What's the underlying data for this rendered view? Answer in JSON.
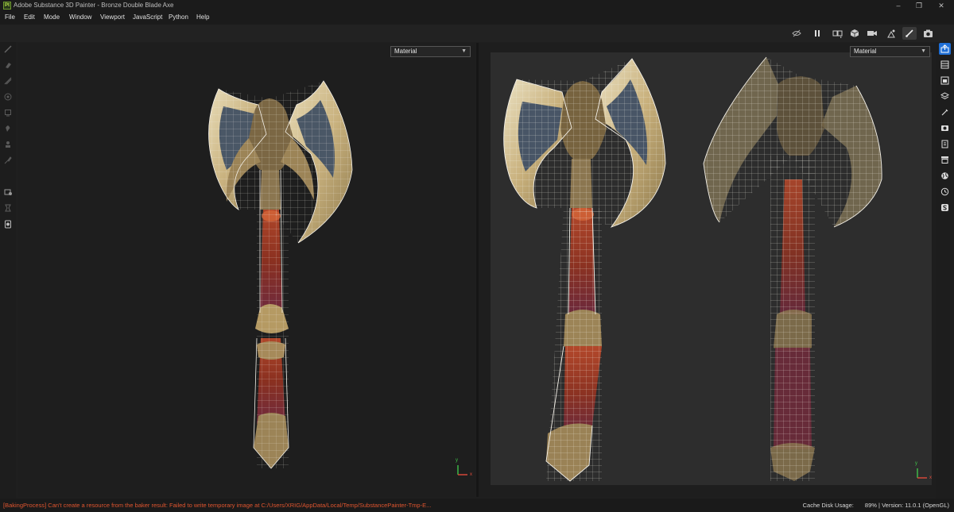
{
  "window": {
    "title": "Adobe Substance 3D Painter - Bronze Double Blade Axe",
    "app_icon": "Pt",
    "controls": [
      "minimize-icon",
      "maximize-icon",
      "close-icon"
    ]
  },
  "menu": [
    "File",
    "Edit",
    "Mode",
    "Window",
    "Viewport",
    "JavaScript",
    "Python",
    "Help"
  ],
  "toolbar": {
    "icons": [
      "hide-icon",
      "pause-icon",
      "split-view-icon",
      "display-cube-icon",
      "camera-icon",
      "scene-icon",
      "paint-brush-icon",
      "screenshot-icon"
    ],
    "active": "paint-brush-icon"
  },
  "left_tools": [
    "paint-icon",
    "eraser-icon",
    "projection-icon",
    "geometry-mask-icon",
    "polygon-fill-icon",
    "smudge-icon",
    "clone-icon",
    "material-picker-icon",
    "bake-icon",
    "measure-icon",
    "color-picker-icon"
  ],
  "right_panels": [
    "export-icon",
    "layers-panel-icon",
    "texture-set-icon",
    "stack-icon",
    "properties-icon",
    "display-settings-icon",
    "shelf-icon",
    "assets-icon",
    "environment-icon",
    "history-icon",
    "substance-icon"
  ],
  "viewport_2d": {
    "mode": "Material"
  },
  "viewport_3d": {
    "mode": "Material"
  },
  "axes": {
    "x_label": "x",
    "y_label": "y"
  },
  "colors": {
    "accent": "#1f6fd6",
    "error": "#e0552f"
  },
  "status": {
    "error": "[BakingProcess] Can't create a resource from the baker result: Failed to write temporary image at C:/Users/XRIG/AppData/Local/Temp/SubstancePainter-Tmp-E...",
    "cache_label": "Cache Disk Usage:",
    "cache_value": "89%",
    "separator": "|",
    "version": "Version: 11.0.1 (OpenGL)"
  }
}
